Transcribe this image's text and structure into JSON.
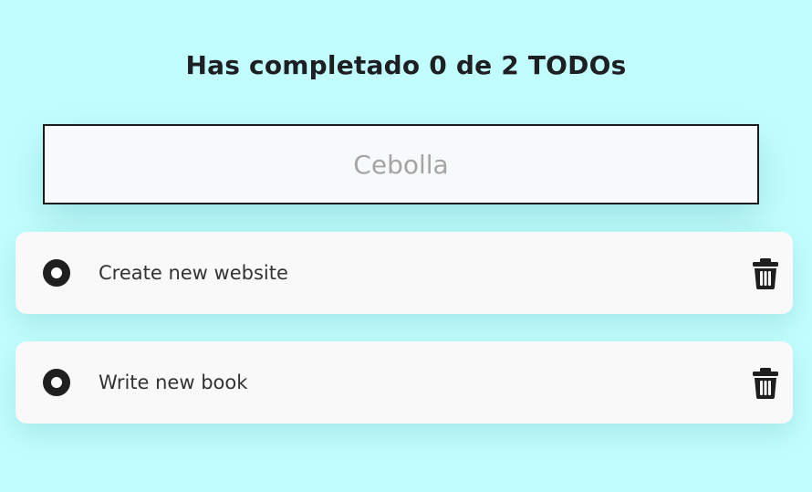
{
  "header": {
    "title": "Has completado 0 de 2 TODOs"
  },
  "new_todo": {
    "placeholder": "Cebolla",
    "value": ""
  },
  "todos": [
    {
      "text": "Create new website",
      "completed": false,
      "delete_icon": "trash-icon",
      "status_icon": "radio-circle-icon"
    },
    {
      "text": "Write new book",
      "completed": false,
      "delete_icon": "trash-icon",
      "status_icon": "radio-circle-icon"
    }
  ],
  "colors": {
    "background": "#c2fdfd",
    "card": "#f9f9f9",
    "text_dark": "#1d1f22",
    "placeholder": "#a4a4a4"
  }
}
